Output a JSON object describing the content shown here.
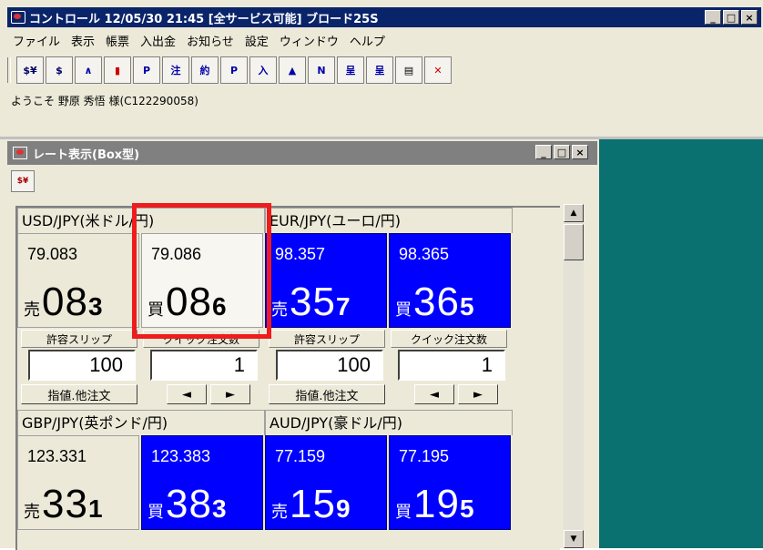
{
  "window": {
    "title": "コントロール 12/05/30 21:45 [全サービス可能] ブロード25S"
  },
  "window_buttons": [
    "_",
    "□",
    "×"
  ],
  "menu": [
    "ファイル",
    "表示",
    "帳票",
    "入出金",
    "お知らせ",
    "設定",
    "ウィンドウ",
    "ヘルプ"
  ],
  "toolbar": {
    "buttons": [
      "$¥",
      "$",
      "∧",
      "▮",
      "P",
      "注",
      "約",
      "P",
      "入",
      "▲",
      "N",
      "呈",
      "呈",
      "▤",
      "✕"
    ]
  },
  "welcome": "ようこそ 野原 秀悟 様(C122290058)",
  "child": {
    "title": "レート表示(Box型)",
    "toolbar_icon": "$¥"
  },
  "pairs": [
    {
      "label": "USD/JPY(米ドル/円)",
      "sell": {
        "rate": "79.083",
        "side": "売",
        "main": "08",
        "last": "3",
        "color": "white"
      },
      "buy": {
        "rate": "79.086",
        "side": "買",
        "main": "08",
        "last": "6",
        "color": "white"
      },
      "slip_label": "許容スリップ",
      "slip_value": "100",
      "qty_label": "クイック注文数",
      "qty_value": "1",
      "order_button": "指値.他注文"
    },
    {
      "label": "EUR/JPY(ユーロ/円)",
      "sell": {
        "rate": "98.357",
        "side": "売",
        "main": "35",
        "last": "7",
        "color": "blue"
      },
      "buy": {
        "rate": "98.365",
        "side": "買",
        "main": "36",
        "last": "5",
        "color": "blue"
      },
      "slip_label": "許容スリップ",
      "slip_value": "100",
      "qty_label": "クイック注文数",
      "qty_value": "1",
      "order_button": "指値.他注文"
    },
    {
      "label": "GBP/JPY(英ポンド/円)",
      "sell": {
        "rate": "123.331",
        "side": "売",
        "main": "33",
        "last": "1",
        "color": "white"
      },
      "buy": {
        "rate": "123.383",
        "side": "買",
        "main": "38",
        "last": "3",
        "color": "blue"
      }
    },
    {
      "label": "AUD/JPY(豪ドル/円)",
      "sell": {
        "rate": "77.159",
        "side": "売",
        "main": "15",
        "last": "9",
        "color": "blue"
      },
      "buy": {
        "rate": "77.195",
        "side": "買",
        "main": "19",
        "last": "5",
        "color": "blue"
      }
    }
  ],
  "arrows": {
    "left": "◄",
    "right": "►"
  },
  "colors": {
    "accent_blue": "#0000ff",
    "highlight_red": "#ee1c1c",
    "mdi_background": "#0b7070"
  }
}
